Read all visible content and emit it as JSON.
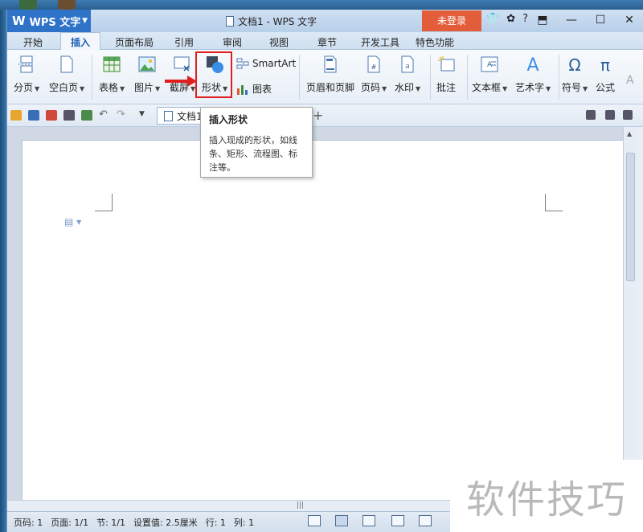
{
  "app": {
    "logo_text": "WPS 文字",
    "window_title": "文档1 - WPS 文字",
    "login_label": "未登录"
  },
  "tabs": [
    {
      "label": "开始"
    },
    {
      "label": "插入",
      "active": true
    },
    {
      "label": "页面布局"
    },
    {
      "label": "引用"
    },
    {
      "label": "审阅"
    },
    {
      "label": "视图"
    },
    {
      "label": "章节"
    },
    {
      "label": "开发工具"
    },
    {
      "label": "特色功能"
    }
  ],
  "ribbon": {
    "page_break": "分页",
    "blank_page": "空白页",
    "table": "表格",
    "picture": "图片",
    "screenshot": "截屏",
    "shape": "形状",
    "smartart": "SmartArt",
    "chart": "图表",
    "header_footer": "页眉和页脚",
    "page_number": "页码",
    "watermark": "水印",
    "comment": "批注",
    "textbox": "文本框",
    "wordart": "艺术字",
    "symbol": "符号",
    "formula": "公式"
  },
  "quickbar": {
    "doc_tab": "文档1"
  },
  "tooltip": {
    "title": "插入形状",
    "body": "插入现成的形状，如线条、矩形、流程图、标注等。"
  },
  "status": {
    "page_no": "页码: 1",
    "pages": "页面: 1/1",
    "section": "节: 1/1",
    "setting": "设置值: 2.5厘米",
    "row": "行: 1",
    "col": "列: 1"
  },
  "watermark_text": "软件技巧",
  "colors": {
    "accent": "#2f73c9",
    "login": "#e35d3b",
    "highlight": "#e11e1e"
  }
}
